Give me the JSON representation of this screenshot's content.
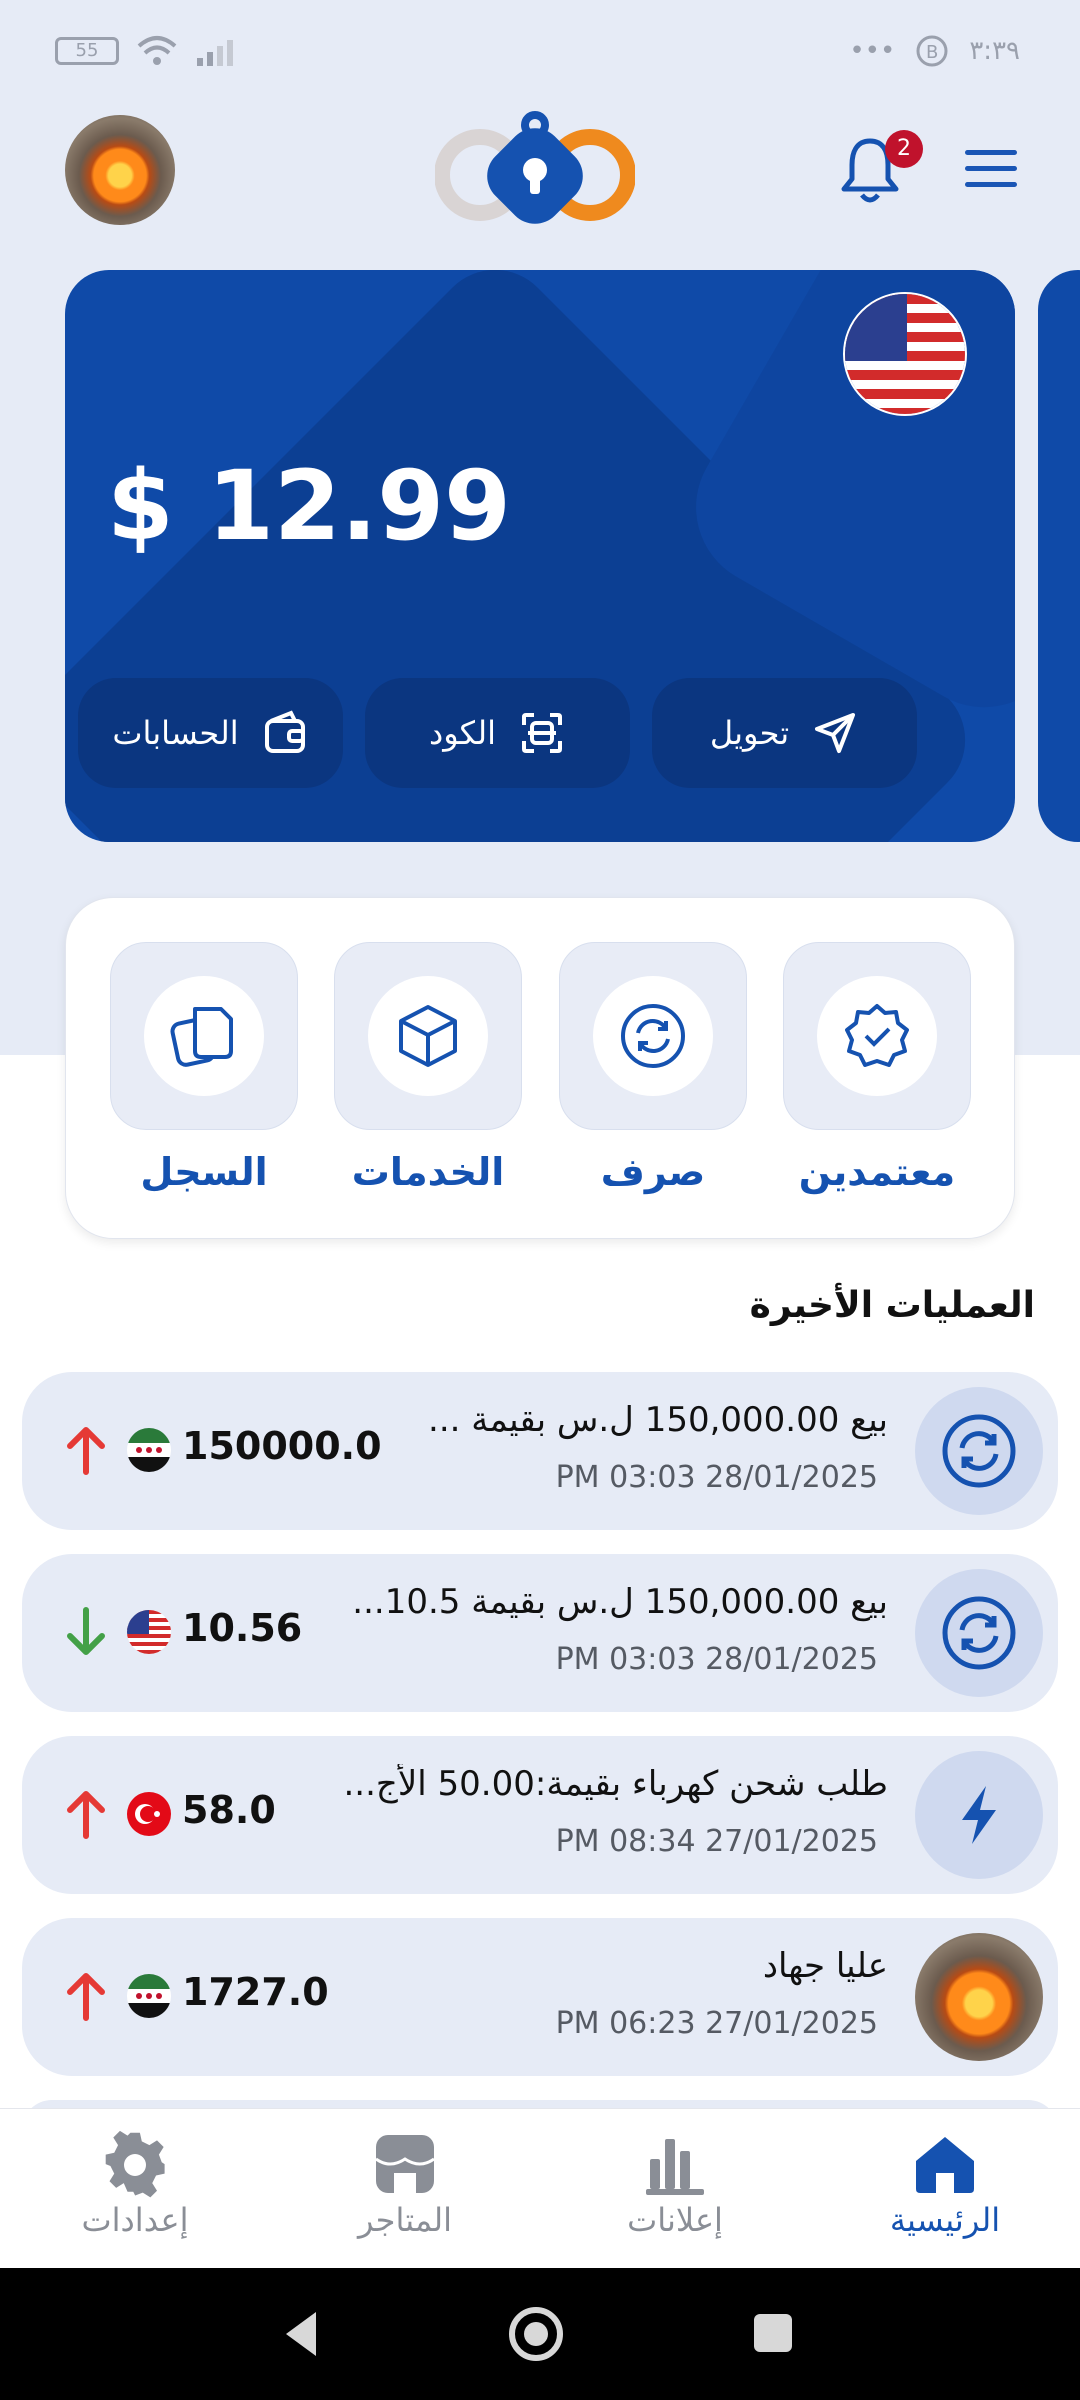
{
  "status_bar": {
    "battery": "55",
    "time": "٣:٣٩",
    "dots": "•••"
  },
  "header": {
    "notification_count": "2"
  },
  "balance_card": {
    "amount": "$ 12.99",
    "buttons": [
      {
        "label": "تحويل",
        "icon": "send-icon"
      },
      {
        "label": "الكود",
        "icon": "scan-icon"
      },
      {
        "label": "الحسابات",
        "icon": "wallet-icon"
      }
    ]
  },
  "quick_actions": [
    {
      "label": "معتمدين",
      "icon": "verified-badge-icon"
    },
    {
      "label": "صرف",
      "icon": "refresh-icon"
    },
    {
      "label": "الخدمات",
      "icon": "box-icon"
    },
    {
      "label": "السجل",
      "icon": "copy-icon"
    }
  ],
  "transactions_title": "العمليات الأخيرة",
  "transactions": [
    {
      "title": "بيع 150,000.00 ل.س بقيمة ...",
      "time": "PM 03:03  28/01/2025",
      "amount": "150000.0",
      "flag": "syria",
      "direction": "up",
      "icon": "exchange-icon"
    },
    {
      "title": "بيع 150,000.00 ل.س بقيمة 10.5...",
      "time": "PM 03:03  28/01/2025",
      "amount": "10.56",
      "flag": "usa",
      "direction": "down",
      "icon": "exchange-icon"
    },
    {
      "title": "طلب شحن كهرباء بقيمة:50.00 الأج...",
      "time": "PM 08:34  27/01/2025",
      "amount": "58.0",
      "flag": "turkey",
      "direction": "up",
      "icon": "lightning-icon"
    },
    {
      "title": "عليا جهاد",
      "time": "PM 06:23  27/01/2025",
      "amount": "1727.0",
      "flag": "syria",
      "direction": "up",
      "icon": "avatar"
    }
  ],
  "bottom_nav": [
    {
      "label": "الرئيسية",
      "icon": "home-icon",
      "active": true
    },
    {
      "label": "إعلانات",
      "icon": "bar-chart-icon",
      "active": false
    },
    {
      "label": "المتاجر",
      "icon": "store-icon",
      "active": false
    },
    {
      "label": "إعدادات",
      "icon": "gear-icon",
      "active": false
    }
  ],
  "colors": {
    "primary": "#0f4aa8",
    "accent": "#1552b0",
    "up_arrow": "#e53935",
    "down_arrow": "#43a047",
    "badge": "#c0122c"
  }
}
